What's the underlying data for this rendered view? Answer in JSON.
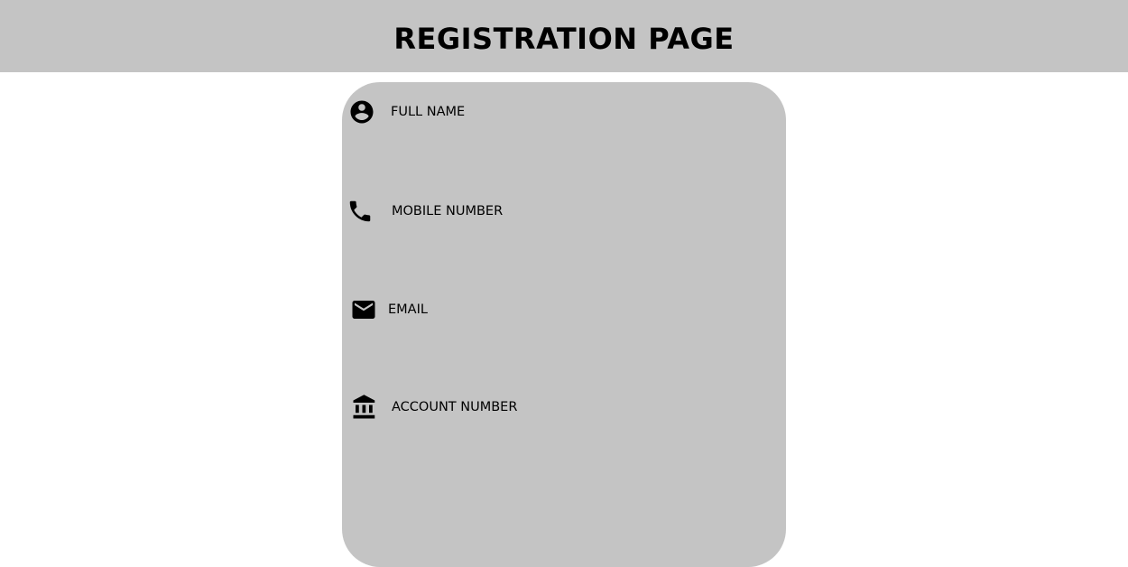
{
  "header": {
    "title": "REGISTRATION PAGE"
  },
  "form": {
    "fields": [
      {
        "label": "FULL NAME",
        "icon": "account-circle-icon"
      },
      {
        "label": "MOBILE NUMBER",
        "icon": "phone-icon"
      },
      {
        "label": "EMAIL",
        "icon": "mail-icon"
      },
      {
        "label": "ACCOUNT NUMBER",
        "icon": "bank-icon"
      }
    ]
  },
  "colors": {
    "header_bg": "#c4c4c4",
    "card_bg": "#c4c4c4",
    "text": "#000000",
    "page_bg": "#ffffff"
  }
}
